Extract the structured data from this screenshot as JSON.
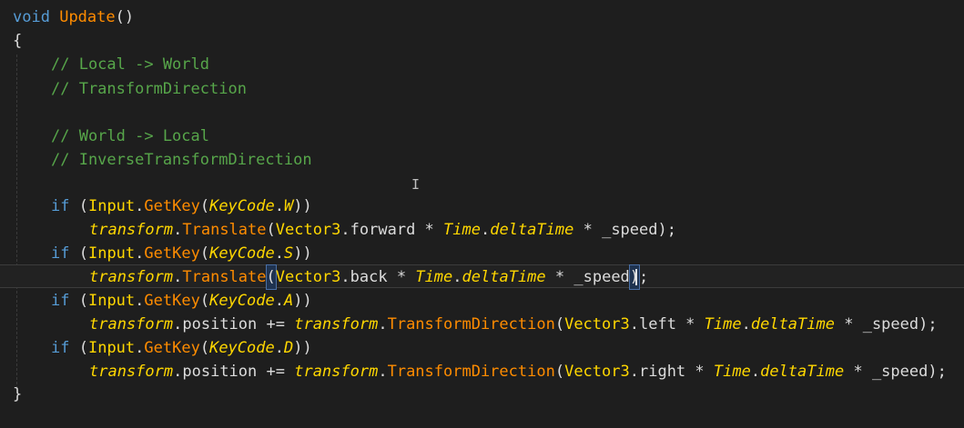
{
  "code": {
    "sig_kw": "void",
    "sig_name": "Update",
    "sig_parens": "()",
    "open_brace": "{",
    "close_brace": "}",
    "comment1": "// Local -> World",
    "comment2": "// TransformDirection",
    "comment3": "// World -> Local",
    "comment4": "// InverseTransformDirection",
    "if_kw": "if",
    "input_cls": "Input",
    "getkey": "GetKey",
    "keycode": "KeyCode",
    "key_w": "W",
    "key_s": "S",
    "key_a": "A",
    "key_d": "D",
    "transform": "transform",
    "translate": "Translate",
    "position": "position",
    "transform_direction": "TransformDirection",
    "vector3": "Vector3",
    "forward": "forward",
    "back": "back",
    "left": "left",
    "right": "right",
    "time": "Time",
    "delta_time": "deltaTime",
    "speed": "_speed"
  },
  "colors": {
    "background": "#1e1e1e",
    "keyword": "#569cd6",
    "method": "#ff8c00",
    "type": "#ffd700",
    "comment": "#57a64a"
  },
  "cursor_icon": "text-ibeam-icon"
}
